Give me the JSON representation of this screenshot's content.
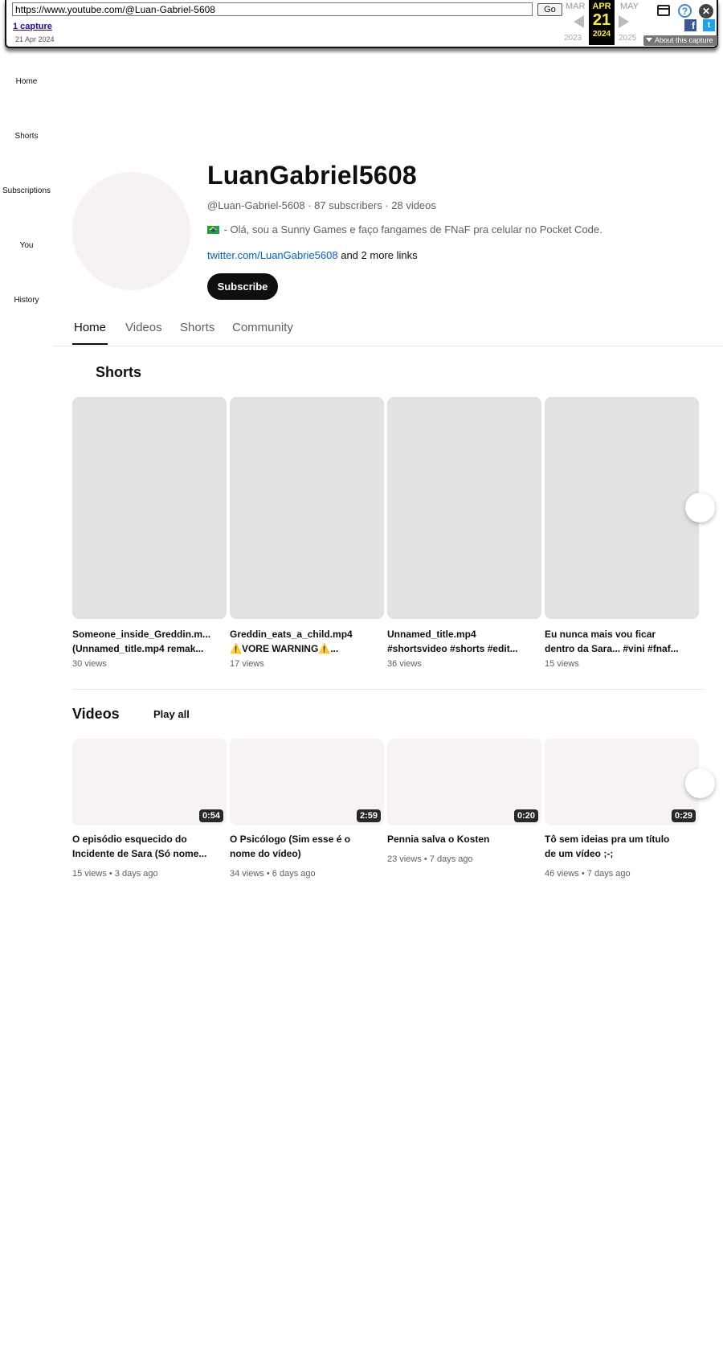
{
  "wayback": {
    "url": "https://www.youtube.com/@Luan-Gabriel-5608",
    "go_label": "Go",
    "captures": "1 capture",
    "capture_date": "21 Apr 2024",
    "prev_month": "MAR",
    "current_month": "APR",
    "next_month": "MAY",
    "current_day": "21",
    "prev_year": "2023",
    "current_year": "2024",
    "next_year": "2025",
    "about": "About this capture"
  },
  "guide": [
    {
      "label": "Home"
    },
    {
      "label": "Shorts"
    },
    {
      "label": "Subscriptions"
    },
    {
      "label": "You"
    },
    {
      "label": "History"
    }
  ],
  "channel": {
    "name": "LuanGabriel5608",
    "meta": "@Luan-Gabriel-5608 · 87 subscribers · 28 videos",
    "description": " - Olá, sou a Sunny Games e faço fangames de FNaF pra celular no Pocket Code.",
    "link": "twitter.com/LuanGabrie5608",
    "more_links": " and 2 more links",
    "subscribe_label": "Subscribe"
  },
  "tabs": [
    {
      "label": "Home"
    },
    {
      "label": "Videos"
    },
    {
      "label": "Shorts"
    },
    {
      "label": "Community"
    }
  ],
  "shorts_shelf": {
    "title": "Shorts",
    "items": [
      {
        "line1": "Someone_inside_Greddin.m...",
        "line2": "(Unnamed_title.mp4 remak...",
        "views": "30 views"
      },
      {
        "line1": "Greddin_eats_a_child.mp4",
        "line2": "⚠️VORE WARNING⚠️...",
        "views": "17 views"
      },
      {
        "line1": "Unnamed_title.mp4",
        "line2": "#shortsvideo #shorts #edit...",
        "views": "36 views"
      },
      {
        "line1": "Eu nunca mais vou ficar",
        "line2": "dentro da Sara... #vini #fnaf...",
        "views": "15 views"
      }
    ]
  },
  "videos_shelf": {
    "title": "Videos",
    "play_all": "Play all",
    "items": [
      {
        "line1": "O episódio esquecido do",
        "line2": "Incidente de Sara (Só nome...",
        "duration": "0:54",
        "views": "15 views",
        "age": "3 days ago"
      },
      {
        "line1": "O Psicólogo (Sim esse é o",
        "line2": "nome do vídeo)",
        "duration": "2:59",
        "views": "34 views",
        "age": "6 days ago"
      },
      {
        "line1": "Pennia salva o Kosten",
        "line2": "",
        "duration": "0:20",
        "views": "23 views",
        "age": "7 days ago"
      },
      {
        "line1": "Tô sem ideias pra um título",
        "line2": "de um vídeo ;-;",
        "duration": "0:29",
        "views": "46 views",
        "age": "7 days ago"
      }
    ]
  },
  "meta_separator": "•"
}
